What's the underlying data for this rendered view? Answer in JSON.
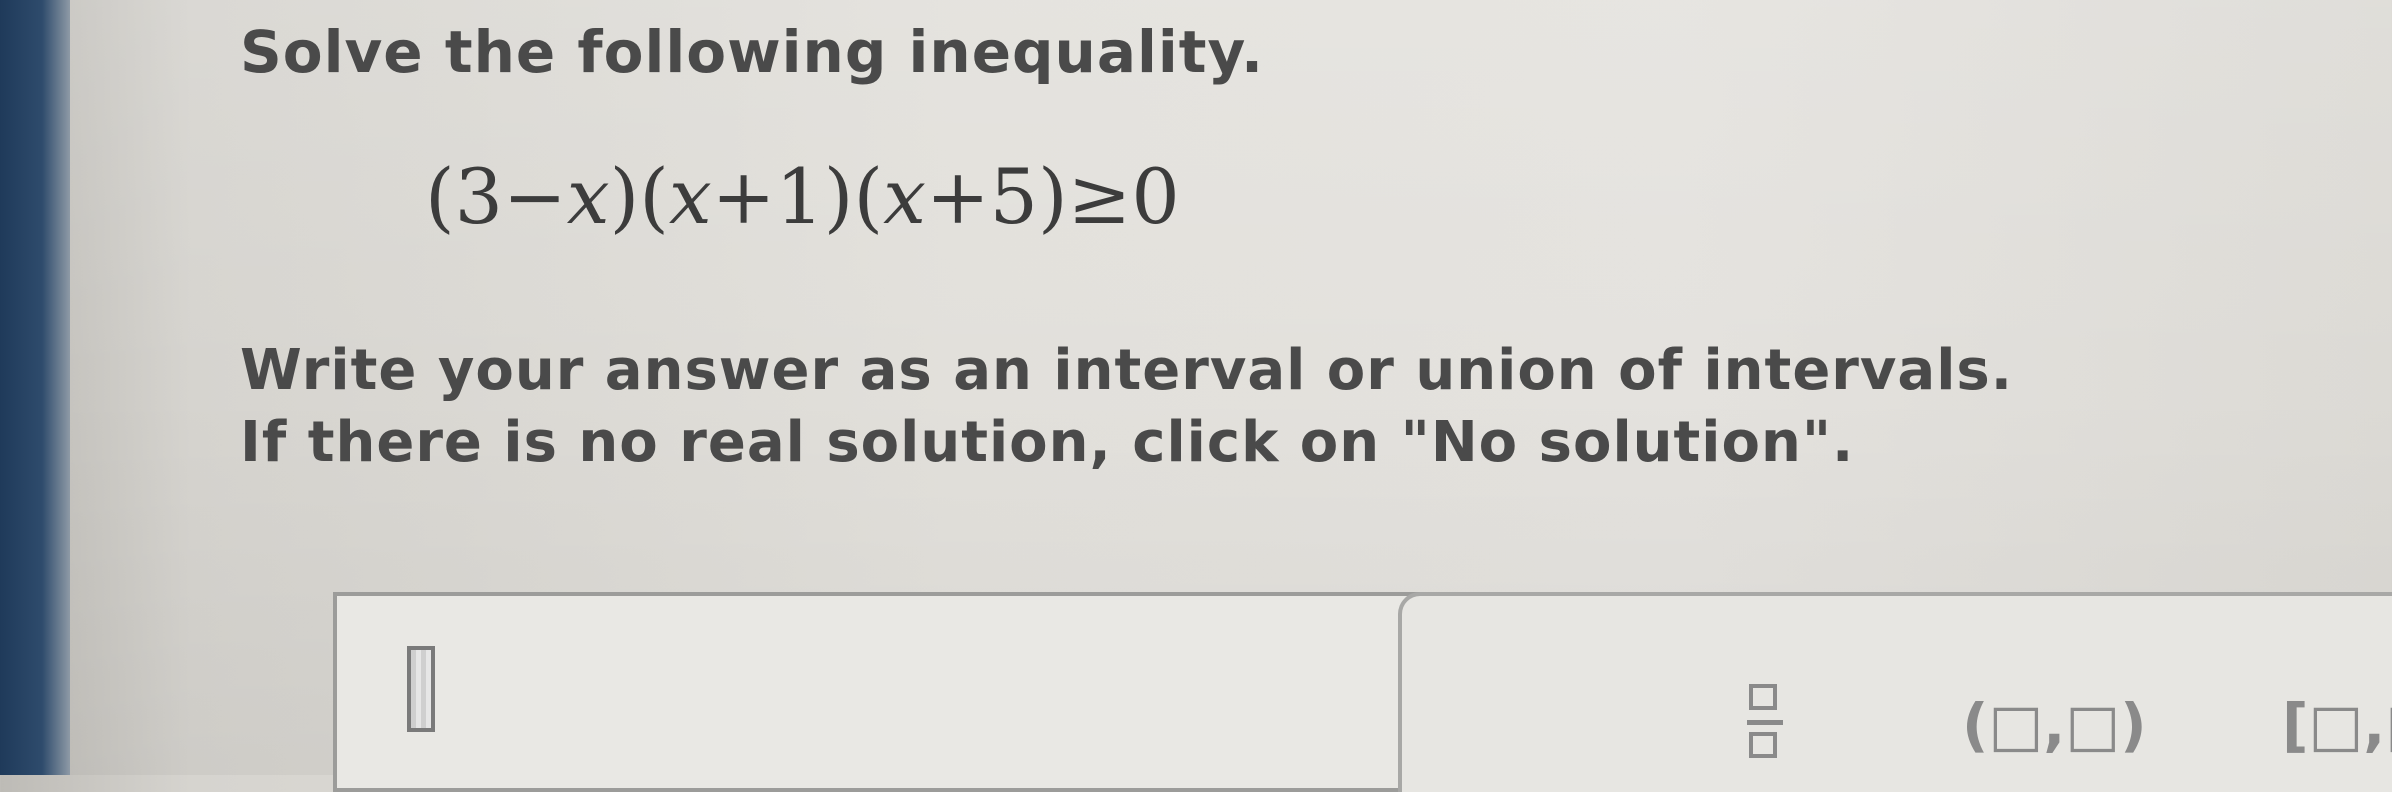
{
  "problem": {
    "instruction": "Solve the following inequality.",
    "equation": {
      "part1_open": "(3",
      "part1_minus": "−",
      "part1_var": "x",
      "part1_close": ")(",
      "part2_var": "x",
      "part2_rest": "+1)(",
      "part3_var": "x",
      "part3_rest": "+5)",
      "relation": "≥",
      "rhs": "0"
    },
    "directions_line1": "Write your answer as an interval or union of intervals.",
    "directions_line2": "If there is no real solution, click on \"No solution\"."
  },
  "answer": {
    "value": ""
  },
  "toolbar": {
    "interval_open_label": "(□,□)",
    "interval_closed_label": "[□,□"
  },
  "icons": {
    "answer_cursor": "cursor-box-icon",
    "fraction_tool": "fraction-icon"
  }
}
